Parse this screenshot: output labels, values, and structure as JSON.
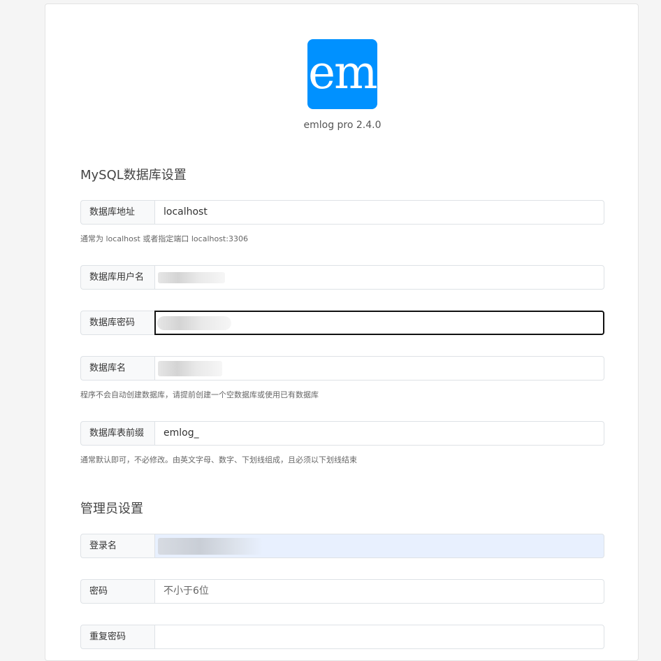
{
  "logo": {
    "text": "em"
  },
  "version": "emlog pro 2.4.0",
  "db_section": {
    "title": "MySQL数据库设置",
    "host": {
      "label": "数据库地址",
      "value": "localhost",
      "help": "通常为 localhost 或者指定端口 localhost:3306"
    },
    "user": {
      "label": "数据库用户名",
      "value": ""
    },
    "password": {
      "label": "数据库密码",
      "value": ""
    },
    "name": {
      "label": "数据库名",
      "value": "",
      "help": "程序不会自动创建数据库，请提前创建一个空数据库或使用已有数据库"
    },
    "prefix": {
      "label": "数据库表前缀",
      "value": "emlog_",
      "help": "通常默认即可，不必修改。由英文字母、数字、下划线组成，且必须以下划线结束"
    }
  },
  "admin_section": {
    "title": "管理员设置",
    "login": {
      "label": "登录名",
      "value": ""
    },
    "password": {
      "label": "密码",
      "placeholder": "不小于6位"
    },
    "repeat": {
      "label": "重复密码",
      "value": ""
    }
  },
  "colors": {
    "brand": "#0091ff",
    "autofill": "#e8f0fe",
    "focus_border": "#111111"
  }
}
